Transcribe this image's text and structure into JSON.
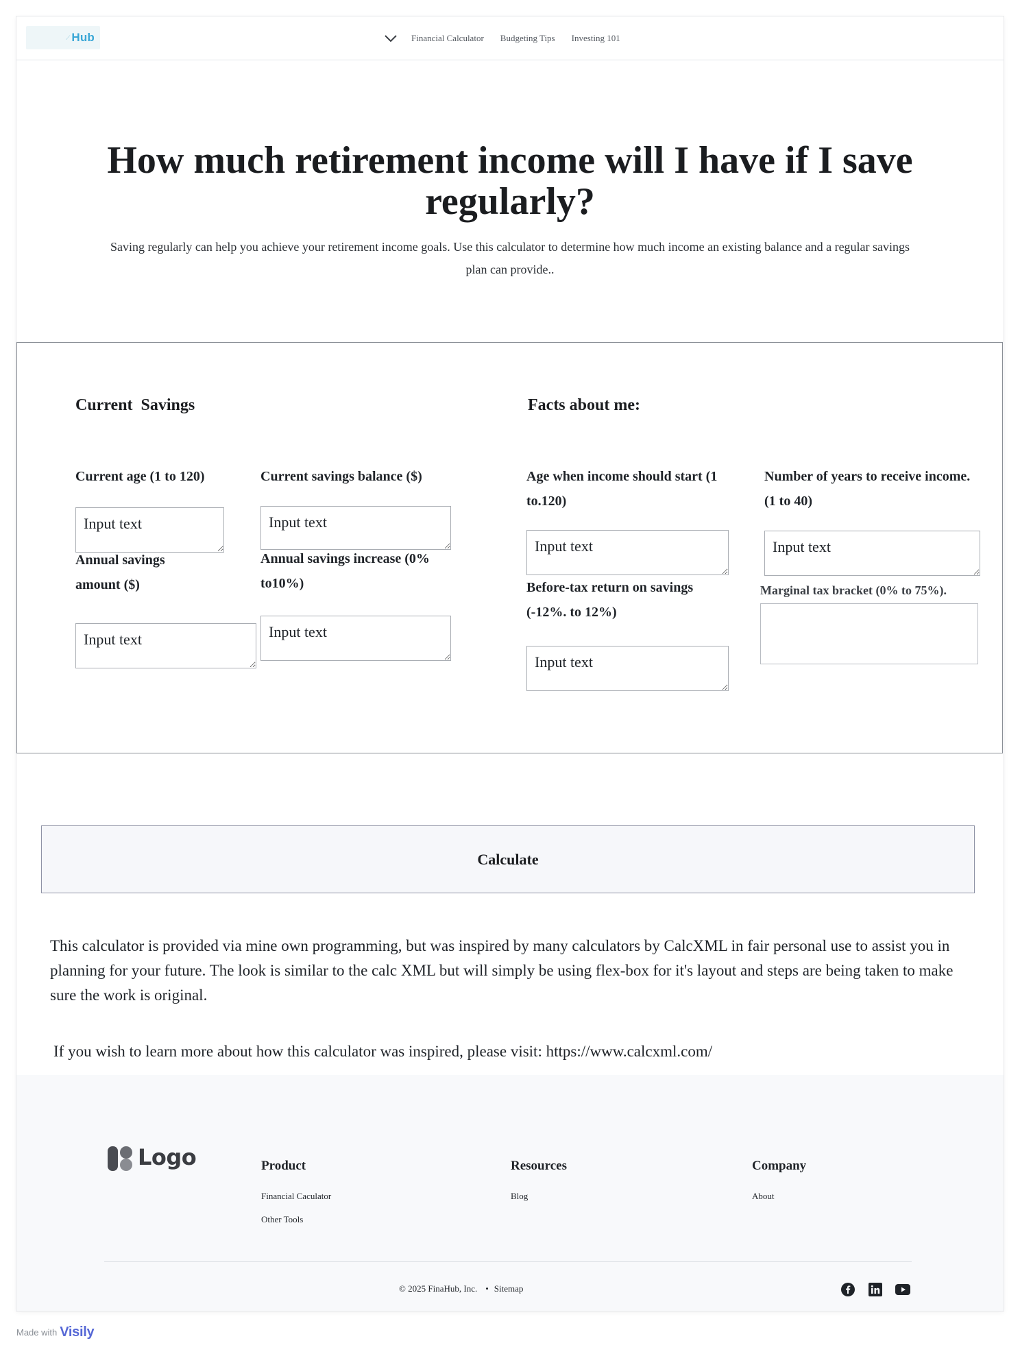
{
  "header": {
    "logo_text": "Hub",
    "nav": {
      "dropdown_icon": "chevron-down-icon",
      "links": [
        "Financial Calculator",
        "Budgeting Tips",
        "Investing 101"
      ]
    }
  },
  "hero": {
    "title": "How much retirement income will I have if I save regularly?",
    "subtitle": "Saving regularly can help you achieve your retirement income goals. Use this calculator to determine how much income an existing balance and a regular savings plan can provide.."
  },
  "form": {
    "current_savings": {
      "title": "Current  Savings",
      "fields": {
        "current_age": {
          "label": "Current age (1 to 120)",
          "placeholder": "Input text"
        },
        "current_balance": {
          "label": "Current savings balance ($)",
          "placeholder": "Input text"
        },
        "annual_amount": {
          "label": "Annual savings amount ($)",
          "placeholder": "Input text"
        },
        "annual_increase": {
          "label": "Annual savings increase (0% to10%)",
          "placeholder": "Input text"
        }
      }
    },
    "facts": {
      "title": "Facts about me:",
      "fields": {
        "income_start_age": {
          "label": "Age when income should start (1 to.120)",
          "placeholder": "Input text"
        },
        "years_receive": {
          "label": "Number of years to receive income. (1 to 40)",
          "placeholder": "Input text"
        },
        "pretax_return": {
          "label": "Before-tax return on savings (-12%.  to 12%)",
          "placeholder": "Input text"
        },
        "tax_bracket": {
          "label": "Marginal tax bracket (0% to 75%).",
          "placeholder": ""
        }
      }
    }
  },
  "calculate_label": "Calculate",
  "info": {
    "paragraph": "This calculator is provided via mine own programming, but was inspired by many calculators by CalcXML in fair personal use to assist you in planning for your future.  The look is similar to the calc XML but will  simply be using flex-box for it's layout and steps are being taken to make sure the work is original.",
    "visit": "If you wish to learn more about how this calculator was inspired, please visit: https://www.calcxml.com/"
  },
  "footer": {
    "logo_text": "Logo",
    "columns": {
      "product": {
        "title": "Product",
        "links": [
          "Financial Caculator",
          "Other Tools"
        ]
      },
      "resources": {
        "title": "Resources",
        "links": [
          "Blog"
        ]
      },
      "company": {
        "title": "Company",
        "links": [
          "About"
        ]
      }
    },
    "copyright": "© 2025 FinaHub, Inc.",
    "separator": "•",
    "sitemap": "Sitemap",
    "social_icons": [
      "facebook-icon",
      "linkedin-icon",
      "youtube-icon"
    ]
  },
  "badge": {
    "made_with": "Made with",
    "brand": "Visily"
  },
  "colors": {
    "logo_accent": "#3aa7d6",
    "footer_bg": "#f8f9fb",
    "badge_brand": "#5668d6"
  }
}
